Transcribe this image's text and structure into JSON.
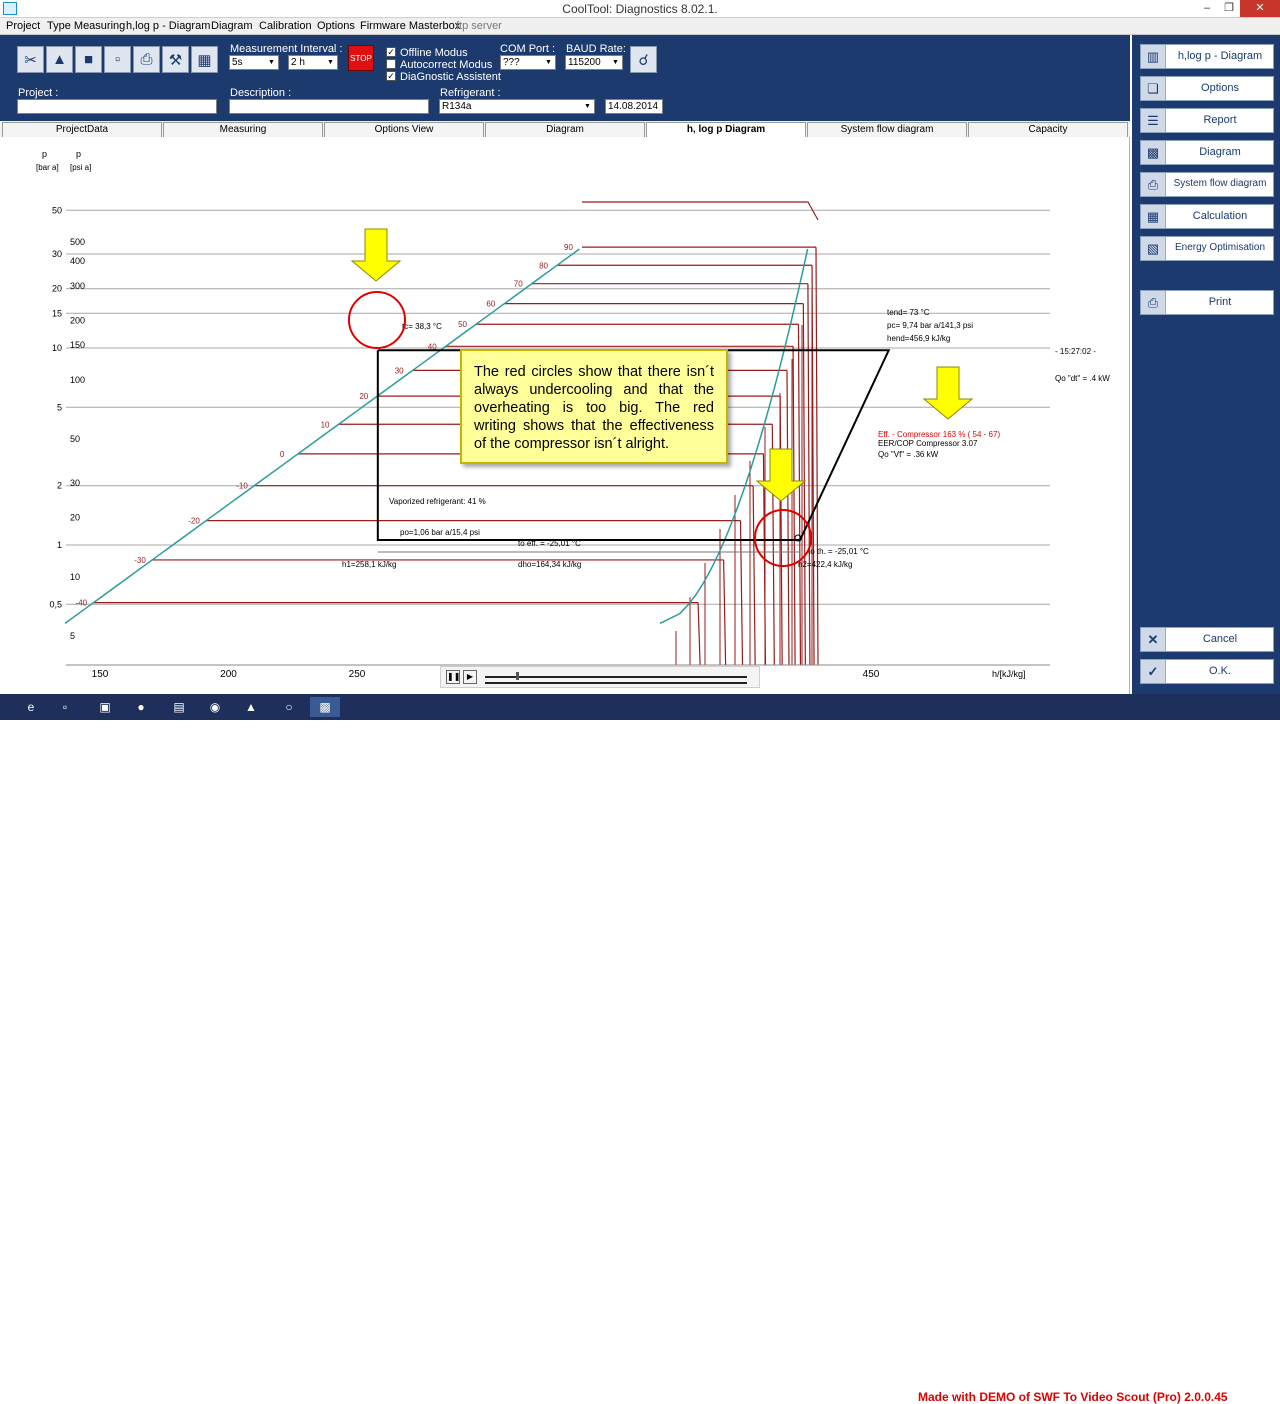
{
  "window": {
    "title": "CoolTool: Diagnostics 8.02.1."
  },
  "menu": [
    "Project",
    "Type Measuring",
    "h,log p - Diagram",
    "Diagram",
    "Calibration",
    "Options",
    "Firmware Masterbox",
    "ftp server"
  ],
  "controls": {
    "measurement_interval_label": "Measurement Interval :",
    "interval_value_1": "5s",
    "interval_value_2": "2 h",
    "stop_label": "STOP",
    "offline_label": "Offline Modus",
    "autocorrect_label": "Autocorrect Modus",
    "assistant_label": "DiaGnostic Assistent",
    "com_port_label": "COM Port :",
    "com_port_value": "???",
    "baud_label": "BAUD Rate:",
    "baud_value": "115200",
    "project_label": "Project :",
    "description_label": "Description :",
    "refrigerant_label": "Refrigerant :",
    "refrigerant_value": "R134a",
    "date_value": "14.08.2014"
  },
  "toolbar_icons": [
    "scissors-icon",
    "upload-icon",
    "save-icon",
    "folder-icon",
    "printer-icon",
    "tools-icon",
    "grid-icon"
  ],
  "tabs": [
    "ProjectData",
    "Measuring",
    "Options View",
    "Diagram",
    "h, log p Diagram",
    "System flow diagram",
    "Capacity"
  ],
  "sidebar": {
    "items": [
      {
        "label": "h,log p - Diagram",
        "icon": "diagram-icon"
      },
      {
        "label": "Options",
        "icon": "options-icon"
      },
      {
        "label": "Report",
        "icon": "report-icon"
      },
      {
        "label": "Diagram",
        "icon": "bar-chart-icon"
      },
      {
        "label": "System flow diagram",
        "icon": "printer-icon"
      },
      {
        "label": "Calculation",
        "icon": "calculator-icon"
      },
      {
        "label": "Energy Optimisation",
        "icon": "energy-icon"
      },
      {
        "label": "Print",
        "icon": "print-icon"
      }
    ],
    "cancel": "Cancel",
    "ok": "O.K."
  },
  "chart_data": {
    "type": "line",
    "title": "",
    "xlabel": "h/[kJ/kg]",
    "ylabel_bar": "p [bar a]",
    "ylabel_psi": "p [psi a]",
    "x_ticks": [
      150,
      200,
      250,
      450
    ],
    "xlim": [
      140,
      460
    ],
    "y_scale": "log",
    "ylim": [
      0.4,
      50
    ],
    "bar_ticks": [
      {
        "v": 50,
        "l": "50"
      },
      {
        "v": 30,
        "l": "30"
      },
      {
        "v": 20,
        "l": "20"
      },
      {
        "v": 15,
        "l": "15"
      },
      {
        "v": 10,
        "l": "10"
      },
      {
        "v": 5,
        "l": "5"
      },
      {
        "v": 2,
        "l": "2"
      },
      {
        "v": 1,
        "l": "1"
      },
      {
        "v": 0.5,
        "l": "0,5"
      }
    ],
    "psi_ticks": [
      {
        "v": 500,
        "l": "500"
      },
      {
        "v": 400,
        "l": "400"
      },
      {
        "v": 300,
        "l": "300"
      },
      {
        "v": 200,
        "l": "200"
      },
      {
        "v": 150,
        "l": "150"
      },
      {
        "v": 100,
        "l": "100"
      },
      {
        "v": 50,
        "l": "50"
      },
      {
        "v": 30,
        "l": "30"
      },
      {
        "v": 20,
        "l": "20"
      },
      {
        "v": 10,
        "l": "10"
      },
      {
        "v": 5,
        "l": "5"
      }
    ],
    "isotherms": [
      {
        "t": "90",
        "p": 32.5
      },
      {
        "t": "80",
        "p": 26.3
      },
      {
        "t": "70",
        "p": 21.2
      },
      {
        "t": "60",
        "p": 16.8
      },
      {
        "t": "50",
        "p": 13.2
      },
      {
        "t": "40",
        "p": 10.2
      },
      {
        "t": "30",
        "p": 7.7
      },
      {
        "t": "20",
        "p": 5.7
      },
      {
        "t": "10",
        "p": 4.1
      },
      {
        "t": "0",
        "p": 2.9
      },
      {
        "t": "-10",
        "p": 2.0
      },
      {
        "t": "-20",
        "p": 1.33
      },
      {
        "t": "-30",
        "p": 0.84
      },
      {
        "t": "-40",
        "p": 0.51
      }
    ],
    "cycle": {
      "high_p": 9.74,
      "low_p": 1.06,
      "h_liquid": 258.1,
      "h_comp_in": 422.4,
      "h_comp_out": 456.9
    },
    "annotations": {
      "tc": "tc=  38,3 °C",
      "tend": "tend= 73 °C",
      "pc": "pc= 9,74 bar a/141,3 psi",
      "hend": "hend=456,9 kJ/kg",
      "time": "- 15:27:02 -",
      "qo_dt": "Qo \"dt\" = .4 kW",
      "eff": "Eff. - Compressor  163 % ( 54 -  67)",
      "eer": "EER/COP Compressor  3.07",
      "qo_vf": "Qo \"Vf\" = .36 kW",
      "vaporized": "Vaporized refrigerant:  41 %",
      "po": "po=1,06 bar a/15,4 psi",
      "to_eff": "to eff. = -25,01 °C",
      "to_th": "to th. = -25,01 °C",
      "h1": "h1=258,1 kJ/kg",
      "dho": "dho=164,34 kJ/kg",
      "h2": "h2=422,4 kJ/kg"
    }
  },
  "callout": "The red circles show that there isn´t always undercooling and that the overheating is too big. The red writing shows that the effectiveness of the compressor isn´t alright.",
  "colors": {
    "panel": "#1c3a6e",
    "dome": "#2a9d9a",
    "isotherm": "#9b1b1b",
    "cycle": "#000000",
    "highlight": "#e00000",
    "arrow": "#ffff00"
  },
  "taskbar": {
    "watermark": "Made with DEMO of SWF To Video Scout (Pro) 2.0.0.45"
  }
}
